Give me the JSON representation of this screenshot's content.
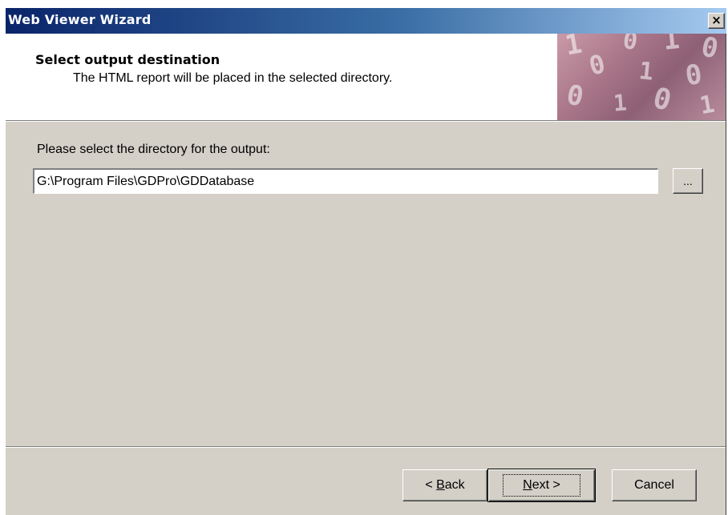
{
  "window": {
    "title": "Web Viewer Wizard",
    "close_glyph": "×"
  },
  "header": {
    "title": "Select output destination",
    "subtitle": "The HTML report will be placed in the selected directory.",
    "art_icon": "binary-digits-banner"
  },
  "body": {
    "prompt": "Please select the directory for the output:",
    "directory_value": "G:\\Program Files\\GDPro\\GDDatabase",
    "browse_label": "..."
  },
  "footer": {
    "back_prefix": "< ",
    "back_key": "B",
    "back_rest": "ack",
    "next_key": "N",
    "next_rest": "ext >",
    "cancel_label": "Cancel"
  },
  "colors": {
    "titlebar_start": "#0a246a",
    "titlebar_end": "#a6caf0",
    "dialog_face": "#d4d0c8"
  }
}
